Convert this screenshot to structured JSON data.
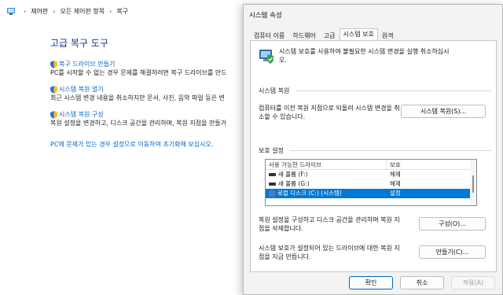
{
  "breadcrumb": {
    "items": [
      "제어판",
      "모든 제어판 항목",
      "복구"
    ]
  },
  "recovery": {
    "title": "고급 복구 도구",
    "tasks": [
      {
        "link": "복구 드라이브 만들기",
        "desc": "PC를 시작할 수 없는 경우 문제를 해결하려면 복구 드라이브를 만드"
      },
      {
        "link": "시스템 복원 열기",
        "desc": "최근 시스템 변경 내용을 취소하지만 문서, 사진, 음악 파일 등은 변"
      },
      {
        "link": "시스템 복원 구성",
        "desc": "복원 설정을 변경하고, 디스크 공간을 관리하며, 복원 지점을 만들거"
      }
    ],
    "reset_link": "PC에 문제가 있는 경우 설정으로 이동하여 초기화해 보십시오."
  },
  "dialog": {
    "title": "시스템 속성",
    "tabs": [
      "컴퓨터 이름",
      "하드웨어",
      "고급",
      "시스템 보호",
      "원격"
    ],
    "active_tab": "시스템 보호",
    "intro": "시스템 보호를 사용하여 불필요한 시스템 변경을 실행 취소하십시오.",
    "restore_section": {
      "heading": "시스템 복원",
      "text": "컴퓨터를 이전 복원 지점으로 되돌려 시스템 변경을 취소할 수 있습니다.",
      "button": "시스템 복원(S)..."
    },
    "protection_section": {
      "heading": "보호 설정",
      "columns": [
        "사용 가능한 드라이브",
        "보호"
      ],
      "drives": [
        {
          "name": "새 볼륨 (F:)",
          "protection": "해제",
          "selected": false
        },
        {
          "name": "새 볼륨 (G:)",
          "protection": "해제",
          "selected": false
        },
        {
          "name": "로컬 디스크 (C:) (시스템)",
          "protection": "설정",
          "selected": true
        }
      ],
      "configure_text": "복원 설정을 구성하고 디스크 공간을 관리하며 복원 지점을 삭제합니다.",
      "configure_button": "구성(O)...",
      "create_text": "시스템 보호가 설정되어 있는 드라이브에 대한 복원 지점을 지금 만듭니다.",
      "create_button": "만들기(C)..."
    },
    "footer": {
      "ok": "확인",
      "cancel": "취소",
      "apply": "적용(A)"
    }
  },
  "colors": {
    "link": "#0066cc",
    "title": "#1e3287",
    "selection": "#0078d7",
    "primary_border": "#0067c0"
  },
  "icons": [
    "control-panel-icon",
    "shield-icon",
    "system-protection-icon",
    "drive-icon",
    "system-drive-icon"
  ]
}
